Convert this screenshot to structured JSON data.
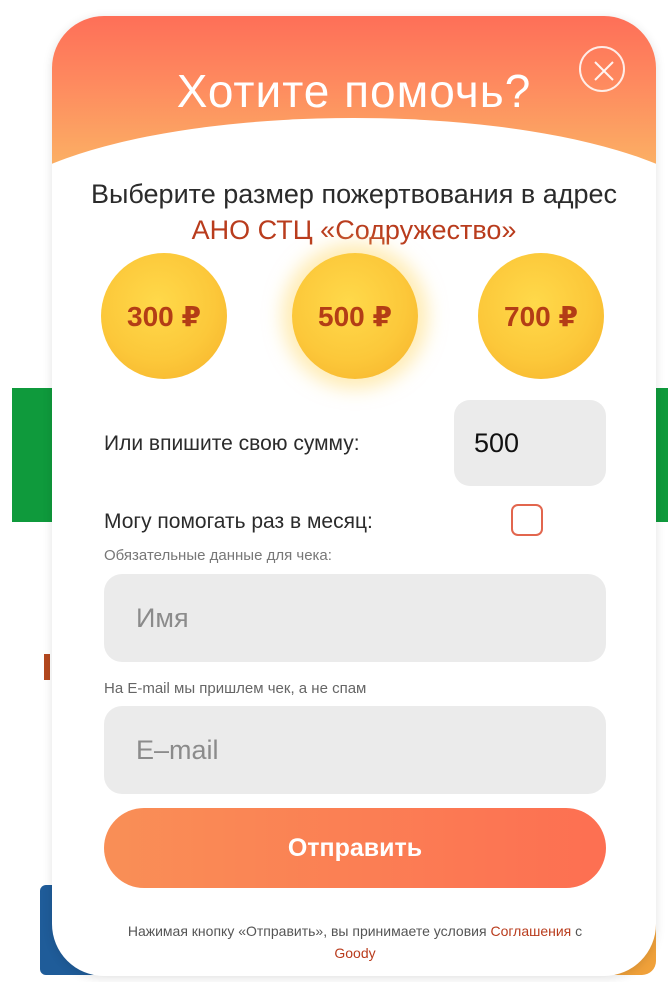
{
  "popup": {
    "title": "Хотите помочь?",
    "close_icon": "close-icon",
    "subtitle_prefix": "Выберите размер пожертвования в адрес ",
    "organization": "АНО СТЦ «Содружество»",
    "amounts": [
      "300 ₽",
      "500 ₽",
      "700 ₽"
    ],
    "selected_amount_index": 1,
    "custom_amount": {
      "label": "Или впишите свою сумму:",
      "value": "500"
    },
    "monthly": {
      "label": "Могу помогать раз в месяц:",
      "checked": false
    },
    "receipt_hint": "Обязательные данные для чека:",
    "name_field": {
      "placeholder": "Имя",
      "value": ""
    },
    "email_hint": "На E-mail мы пришлем чек, а не спам",
    "email_field": {
      "placeholder": "E–mail",
      "value": ""
    },
    "submit_label": "Отправить",
    "legal": {
      "text_before": "Нажимая кнопку «Отправить», вы принимаете условия ",
      "agreement_link": "Соглашения",
      "text_middle": " с ",
      "goody_link": "Goody"
    },
    "colors": {
      "accent": "#fd6f52",
      "link": "#b93c1d",
      "coin": "#fcc83a",
      "coin_text": "#b33d16"
    }
  }
}
